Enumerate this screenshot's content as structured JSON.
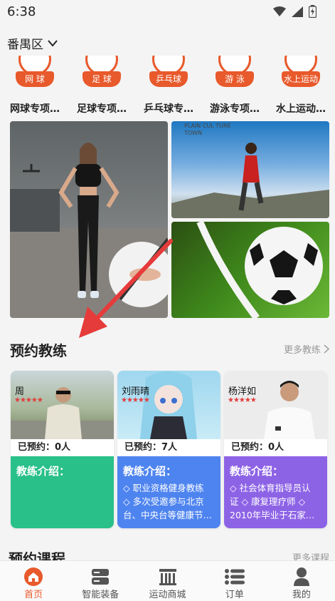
{
  "status_bar": {
    "time": "6:38"
  },
  "location": {
    "label": "番禺区"
  },
  "categories": [
    {
      "badge": "网 球",
      "name": "网球专项…"
    },
    {
      "badge": "足 球",
      "name": "足球专项…"
    },
    {
      "badge": "乒乓球",
      "name": "乒乓球专…"
    },
    {
      "badge": "游 泳",
      "name": "游泳专项…"
    },
    {
      "badge": "水上运动",
      "name": "水上运动…"
    }
  ],
  "banner_text": {
    "line1": "PLAIN CUL TURE",
    "line2": "TOWN"
  },
  "coaches_section": {
    "title": "预约教练",
    "more": "更多教练"
  },
  "coaches": [
    {
      "name": "周",
      "booked": "已预约：0人",
      "intro_title": "教练介绍：",
      "intro_lines": []
    },
    {
      "name": "刘雨晴",
      "booked": "已预约：7人",
      "intro_title": "教练介绍：",
      "intro_lines": [
        "◇ 职业资格健身教练",
        "◇ 多次受邀参与北京",
        "台、中央台等健康节…"
      ]
    },
    {
      "name": "杨洋如",
      "booked": "已预约：0人",
      "intro_title": "教练介绍：",
      "intro_lines": [
        "◇ 社会体育指导员认",
        "证 ◇ 康复理疗师 ◇",
        "2010年毕业于石家…"
      ]
    }
  ],
  "courses_section": {
    "title": "预约课程",
    "more": "更多课程"
  },
  "nav": [
    {
      "label": "首页",
      "icon": "home-icon",
      "active": true
    },
    {
      "label": "智能装备",
      "icon": "device-icon",
      "active": false
    },
    {
      "label": "运动商城",
      "icon": "store-icon",
      "active": false
    },
    {
      "label": "订单",
      "icon": "order-list-icon",
      "active": false
    },
    {
      "label": "我的",
      "icon": "profile-icon",
      "active": false
    }
  ],
  "colors": {
    "accent": "#e8592b",
    "card_green": "#29c08a",
    "card_blue": "#4e84ef",
    "card_purple": "#8d63e6"
  }
}
